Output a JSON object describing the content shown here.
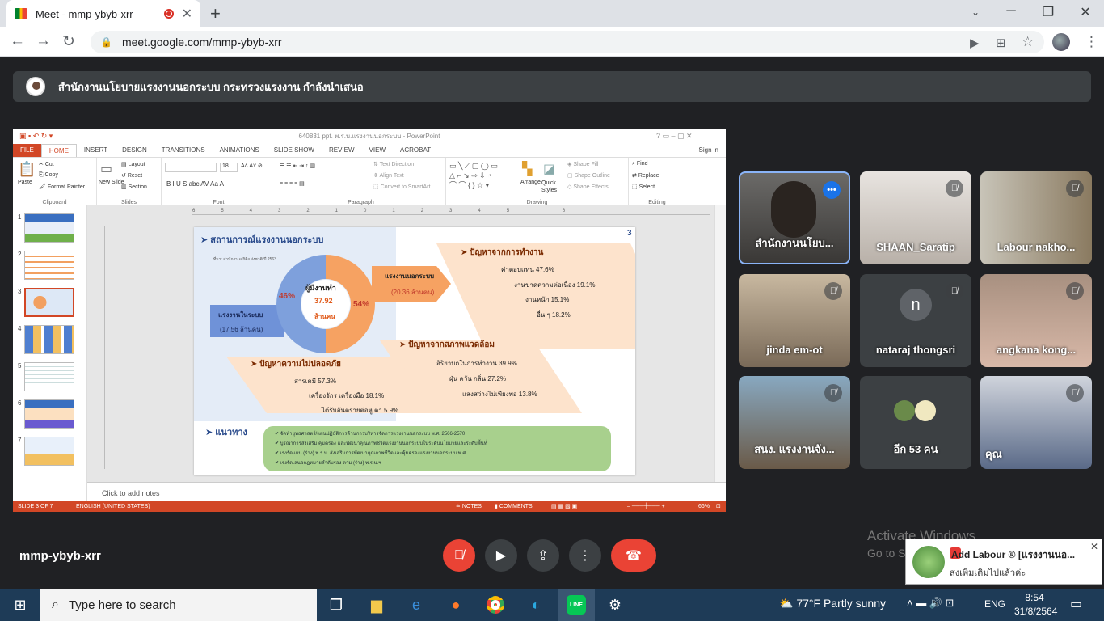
{
  "browser": {
    "tab_title": "Meet - mmp-ybyb-xrr",
    "new_tab": "+",
    "url": "meet.google.com/mmp-ybyb-xrr"
  },
  "meet": {
    "presenter_banner": "สำนักงานนโยบายแรงงานนอกระบบ กระทรวงแรงงาน กำลังนำเสนอ",
    "meeting_code": "mmp-ybyb-xrr",
    "participants": [
      {
        "name": "สำนักงานนโยบ...",
        "muted": false,
        "active": true
      },
      {
        "name": "SHAAN_Saratip",
        "muted": true
      },
      {
        "name": "Labour nakho...",
        "muted": true
      },
      {
        "name": "jinda em-ot",
        "muted": true
      },
      {
        "name": "nataraj thongsri",
        "muted": true,
        "initial": "n"
      },
      {
        "name": "angkana kong...",
        "muted": true
      },
      {
        "name": "สนง. แรงงานจัง...",
        "muted": true
      },
      {
        "name": "อีก 53 คน",
        "muted": false
      },
      {
        "name": "คุณ",
        "muted": true
      }
    ],
    "activate_windows": "Activate Windows",
    "activate_sub": "Go to Se",
    "notification": {
      "title": "Add Labour ® [แรงงานนอ...",
      "body": "ส่งเพิ่มเติมไปแล้วค่ะ"
    }
  },
  "powerpoint": {
    "title": "640831 ppt. พ.ร.บ.แรงงานนอกระบบ - PowerPoint",
    "tabs": [
      "FILE",
      "HOME",
      "INSERT",
      "DESIGN",
      "TRANSITIONS",
      "ANIMATIONS",
      "SLIDE SHOW",
      "REVIEW",
      "VIEW",
      "ACROBAT"
    ],
    "signin": "Sign in",
    "ribbon": {
      "clipboard": {
        "label": "Clipboard",
        "paste": "Paste",
        "cut": "Cut",
        "copy": "Copy",
        "format_painter": "Format Painter"
      },
      "slides": {
        "label": "Slides",
        "new_slide": "New Slide",
        "layout": "Layout",
        "reset": "Reset",
        "section": "Section"
      },
      "font": {
        "label": "Font",
        "size": "18"
      },
      "paragraph": {
        "label": "Paragraph",
        "text_direction": "Text Direction",
        "align_text": "Align Text",
        "convert": "Convert to SmartArt"
      },
      "drawing": {
        "label": "Drawing",
        "arrange": "Arrange",
        "quick_styles": "Quick Styles",
        "shape_fill": "Shape Fill",
        "shape_outline": "Shape Outline",
        "shape_effects": "Shape Effects"
      },
      "editing": {
        "label": "Editing",
        "find": "Find",
        "replace": "Replace",
        "select": "Select"
      }
    },
    "thumbnail_numbers": [
      "1",
      "2",
      "3",
      "4",
      "5",
      "6",
      "7"
    ],
    "notes_placeholder": "Click to add notes",
    "status": {
      "slide": "SLIDE 3 OF 7",
      "language": "ENGLISH (UNITED STATES)",
      "notes": "NOTES",
      "comments": "COMMENTS",
      "zoom": "66%"
    },
    "slide": {
      "number": "3",
      "heading": "สถานการณ์แรงงานนอกระบบ",
      "source": "ที่มา: สำนักงานสถิติแห่งชาติ ปี 2563",
      "donut_center": [
        "ผู้มีงานทำ",
        "37.92",
        "ล้านคน"
      ],
      "pct_formal": "46%",
      "pct_informal": "54%",
      "formal_label": "แรงงานในระบบ",
      "formal_value": "(17.56 ล้านคน)",
      "informal_label": "แรงงานนอกระบบ",
      "informal_value": "(20.36 ล้านคน)",
      "work_problems": {
        "title": "ปัญหาจากการทำงาน",
        "items": [
          "ค่าตอบแทน 47.6%",
          "งานขาดความต่อเนื่อง 19.1%",
          "งานหนัก 15.1%",
          "อื่น ๆ 18.2%"
        ]
      },
      "env_problems": {
        "title": "ปัญหาจากสภาพแวดล้อม",
        "items": [
          "อิริยาบถในการทำงาน 39.9%",
          "ฝุ่น ควัน กลิ่น 27.2%",
          "แสงสว่างไม่เพียงพอ 13.8%"
        ]
      },
      "safety_problems": {
        "title": "ปัญหาความไม่ปลอดภัย",
        "items": [
          "สารเคมี 57.3%",
          "เครื่องจักร เครื่องมือ 18.1%",
          "ได้รับอันตรายต่อหู ตา 5.9%"
        ]
      },
      "approach": {
        "title": "แนวทาง",
        "items": [
          "จัดทำยุทธศาสตร์/แผนปฏิบัติการด้านการบริหารจัดการแรงงานนอกระบบ พ.ศ. 2566-2570",
          "บูรณาการส่งเสริม คุ้มครอง และพัฒนาคุณภาพชีวิตแรงงานนอกระบบในระดับนโยบายและระดับพื้นที่",
          "เร่งรัดแผน (ร่าง) พ.ร.บ. ส่งเสริมการพัฒนาคุณภาพชีวิตและคุ้มครองแรงงานนอกระบบ พ.ศ. ....",
          "เร่งรัดเสนอกฎหมายลำดับรอง ตาม (ร่าง) พ.ร.บ.ฯ"
        ]
      }
    }
  },
  "taskbar": {
    "search_placeholder": "Type here to search",
    "weather": "77°F  Partly sunny",
    "lang": "ENG",
    "time": "8:54",
    "date": "31/8/2564"
  },
  "colors": {
    "meet_bg": "#202124",
    "ppt_accent": "#d24726",
    "end_call": "#ea4335",
    "tile_active": "#8ab4f8"
  }
}
